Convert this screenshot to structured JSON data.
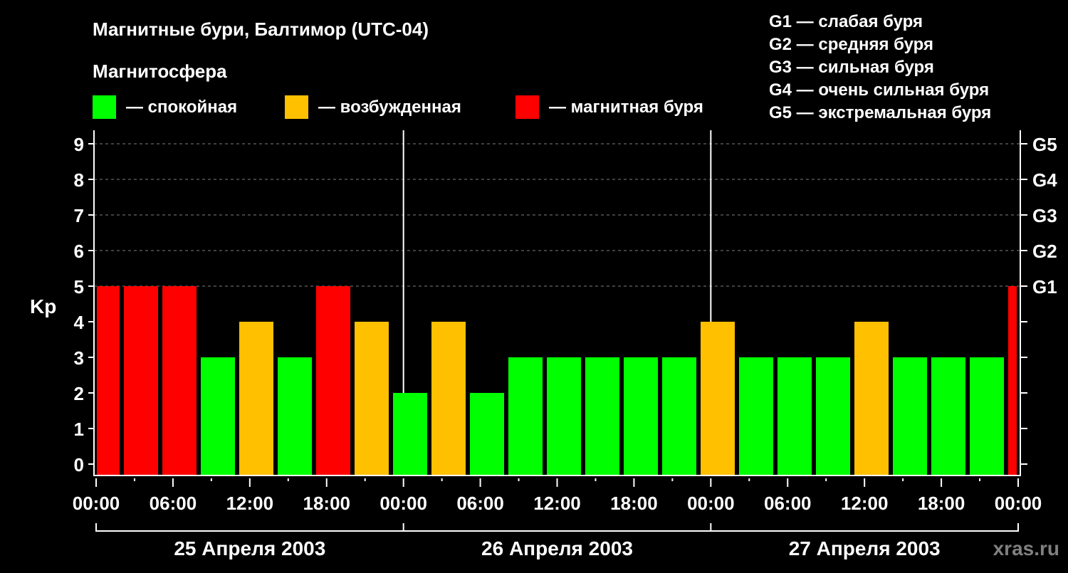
{
  "chart_data": {
    "type": "bar",
    "title": "Магнитные бури, Балтимор (UTC-04)",
    "legend_title": "Магнитосфера",
    "legend": [
      {
        "label": "— спокойная",
        "color": "#00ff00"
      },
      {
        "label": "— возбужденная",
        "color": "#ffc000"
      },
      {
        "label": "— магнитная буря",
        "color": "#ff0000"
      }
    ],
    "g_scale": [
      "G1 — слабая буря",
      "G2 — средняя буря",
      "G3 — сильная буря",
      "G4 — очень сильная буря",
      "G5 — экстремальная буря"
    ],
    "ylabel": "Kp",
    "ylim": [
      0,
      9
    ],
    "yticks": [
      "0",
      "1",
      "2",
      "3",
      "4",
      "5",
      "6",
      "7",
      "8",
      "9"
    ],
    "right_ticks": [
      {
        "value": 5,
        "label": "G1"
      },
      {
        "value": 6,
        "label": "G2"
      },
      {
        "value": 7,
        "label": "G3"
      },
      {
        "value": 8,
        "label": "G4"
      },
      {
        "value": 9,
        "label": "G5"
      }
    ],
    "xticks": [
      "00:00",
      "06:00",
      "12:00",
      "18:00",
      "00:00",
      "06:00",
      "12:00",
      "18:00",
      "00:00",
      "06:00",
      "12:00",
      "18:00",
      "00:00"
    ],
    "dates": [
      "25 Апреля 2003",
      "26 Апреля 2003",
      "27 Апреля 2003"
    ],
    "bar_interval_hours": 3,
    "values": [
      5,
      5,
      5,
      3,
      4,
      3,
      5,
      4,
      2,
      4,
      2,
      3,
      3,
      3,
      3,
      3,
      4,
      3,
      3,
      3,
      4,
      3,
      3,
      3,
      5
    ],
    "colors": {
      "quiet": "#00ff00",
      "active": "#ffc000",
      "storm": "#ff0000"
    },
    "watermark": "xras.ru"
  }
}
